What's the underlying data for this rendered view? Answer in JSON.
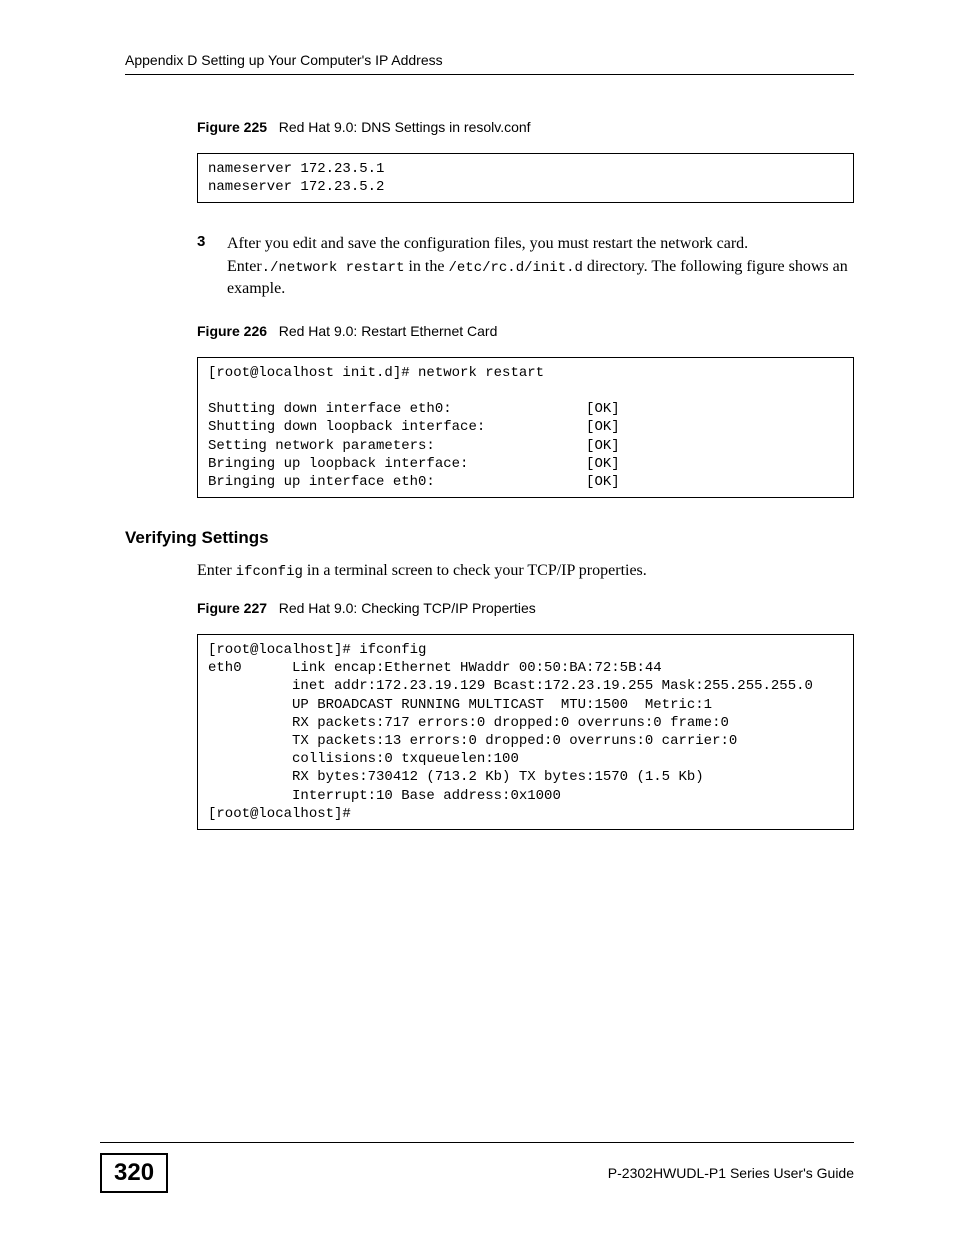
{
  "header": "Appendix D Setting up Your Computer's IP Address",
  "fig225": {
    "label": "Figure 225",
    "title": "Red Hat 9.0: DNS Settings in resolv.conf",
    "code": "nameserver 172.23.5.1\nnameserver 172.23.5.2"
  },
  "step3": {
    "num": "3",
    "text_before": "After you edit and save the configuration files, you must restart the network card. Enter",
    "cmd": "./network restart",
    "text_mid": " in the ",
    "path": "/etc/rc.d/init.d",
    "text_after": " directory. The following figure shows an example."
  },
  "fig226": {
    "label": "Figure 226",
    "title": "Red Hat 9.0: Restart Ethernet Card",
    "code": "[root@localhost init.d]# network restart\n\nShutting down interface eth0:                [OK]\nShutting down loopback interface:            [OK]\nSetting network parameters:                  [OK]\nBringing up loopback interface:              [OK]\nBringing up interface eth0:                  [OK]"
  },
  "verifying": {
    "heading": "Verifying Settings",
    "para_before": "Enter ",
    "cmd": "ifconfig",
    "para_after": " in a terminal screen to check your TCP/IP properties."
  },
  "fig227": {
    "label": "Figure 227",
    "title": "Red Hat 9.0: Checking TCP/IP Properties",
    "code": "[root@localhost]# ifconfig \neth0      Link encap:Ethernet HWaddr 00:50:BA:72:5B:44 \n          inet addr:172.23.19.129 Bcast:172.23.19.255 Mask:255.255.255.0\n          UP BROADCAST RUNNING MULTICAST  MTU:1500  Metric:1\n          RX packets:717 errors:0 dropped:0 overruns:0 frame:0\n          TX packets:13 errors:0 dropped:0 overruns:0 carrier:0\n          collisions:0 txqueuelen:100 \n          RX bytes:730412 (713.2 Kb) TX bytes:1570 (1.5 Kb)\n          Interrupt:10 Base address:0x1000 \n[root@localhost]#"
  },
  "footer": {
    "page": "320",
    "guide": "P-2302HWUDL-P1 Series User's Guide"
  }
}
